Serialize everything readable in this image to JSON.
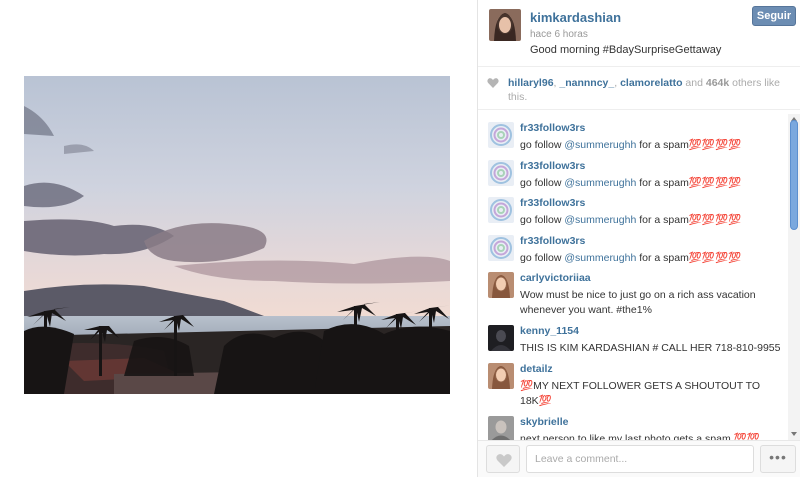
{
  "post": {
    "username": "kimkardashian",
    "time": "hace 6 horas",
    "caption": "Good morning #BdaySurpriseGettaway",
    "follow_label": "Seguir"
  },
  "likes": {
    "likers": [
      "hillaryl96",
      "_nannncy_",
      "clamorelatto"
    ],
    "sep1": ", ",
    "sep2": ", ",
    "and": " and ",
    "count": "464k",
    "suffix": " others like this."
  },
  "comments": [
    {
      "user": "fr33follow3rs",
      "pre": "go follow ",
      "mention": "@summerughh",
      "post": " for a spam💯💯💯💯",
      "avatar": "spiral-avatar"
    },
    {
      "user": "fr33follow3rs",
      "pre": "go follow ",
      "mention": "@summerughh",
      "post": " for a spam💯💯💯💯",
      "avatar": "spiral-avatar"
    },
    {
      "user": "fr33follow3rs",
      "pre": "go follow ",
      "mention": "@summerughh",
      "post": " for a spam💯💯💯💯",
      "avatar": "spiral-avatar"
    },
    {
      "user": "fr33follow3rs",
      "pre": "go follow ",
      "mention": "@summerughh",
      "post": " for a spam💯💯💯💯",
      "avatar": "spiral-avatar"
    },
    {
      "user": "carlyvictoriiaa",
      "pre": "Wow must be nice to just go on a rich ass vacation whenever you want. #the1%",
      "mention": "",
      "post": "",
      "avatar": "portrait-avatar"
    },
    {
      "user": "kenny_1154",
      "pre": "THIS IS KIM KARDASHIAN # CALL HER 718-810-9955",
      "mention": "",
      "post": "",
      "avatar": "dark-avatar"
    },
    {
      "user": "detailz",
      "pre": "💯MY NEXT FOLLOWER GETS A SHOUTOUT TO 18K💯",
      "mention": "",
      "post": "",
      "avatar": "portrait-avatar"
    },
    {
      "user": "skybrielle",
      "pre": "next person to like my last photo gets a spam 💯💯",
      "mention": "",
      "post": "",
      "avatar": "grey-avatar"
    }
  ],
  "comment_box": {
    "placeholder": "Leave a comment..."
  },
  "more_label": "•••",
  "colors": {
    "link": "#3f729b",
    "follow_button": "#6c8db3",
    "scroll_thumb": "#7aa8de"
  },
  "icons": [
    "heart-icon",
    "ellipsis-icon",
    "scroll-up-arrow-icon",
    "scroll-down-arrow-icon"
  ]
}
